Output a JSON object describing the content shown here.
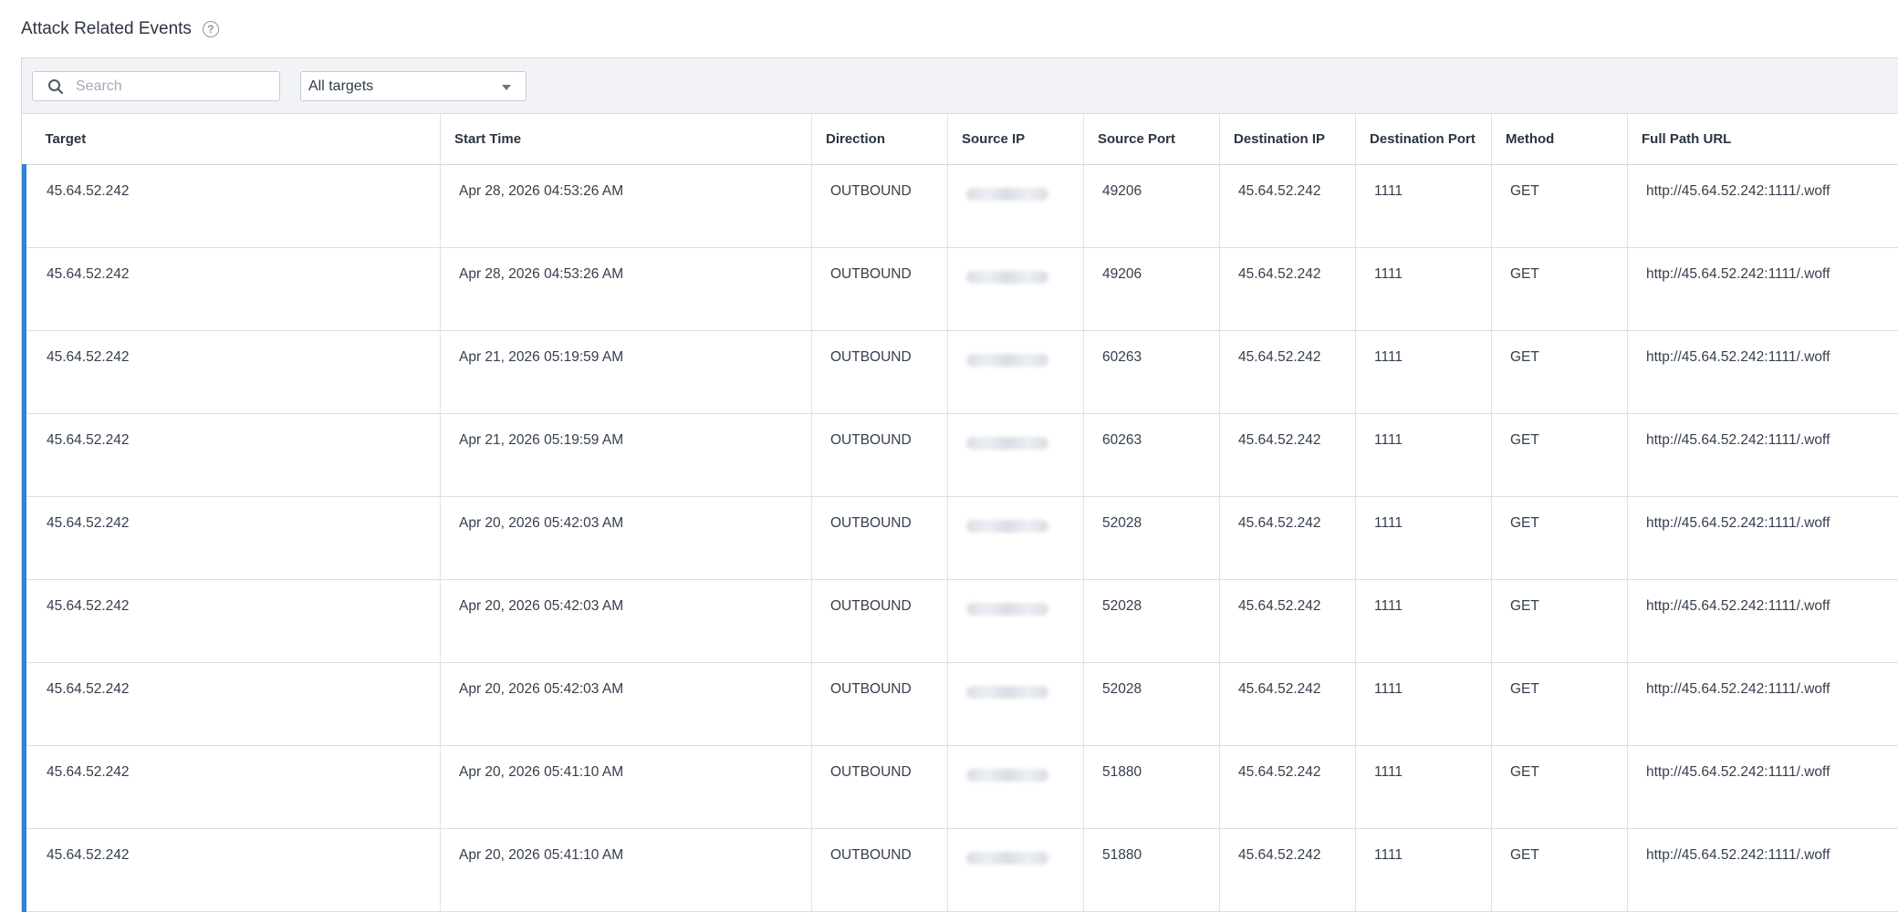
{
  "header": {
    "title": "Attack Related Events",
    "help_glyph": "?"
  },
  "toolbar": {
    "search_placeholder": "Search",
    "target_filter_value": "All targets"
  },
  "table": {
    "columns": [
      "Target",
      "Start Time",
      "Direction",
      "Source IP",
      "Source Port",
      "Destination IP",
      "Destination Port",
      "Method",
      "Full Path URL"
    ],
    "rows": [
      [
        "45.64.52.242",
        "Apr 28, 2026 04:53:26 AM",
        "OUTBOUND",
        "",
        "49206",
        "45.64.52.242",
        "1111",
        "GET",
        "http://45.64.52.242:1111/.woff"
      ],
      [
        "45.64.52.242",
        "Apr 28, 2026 04:53:26 AM",
        "OUTBOUND",
        "",
        "49206",
        "45.64.52.242",
        "1111",
        "GET",
        "http://45.64.52.242:1111/.woff"
      ],
      [
        "45.64.52.242",
        "Apr 21, 2026 05:19:59 AM",
        "OUTBOUND",
        "",
        "60263",
        "45.64.52.242",
        "1111",
        "GET",
        "http://45.64.52.242:1111/.woff"
      ],
      [
        "45.64.52.242",
        "Apr 21, 2026 05:19:59 AM",
        "OUTBOUND",
        "",
        "60263",
        "45.64.52.242",
        "1111",
        "GET",
        "http://45.64.52.242:1111/.woff"
      ],
      [
        "45.64.52.242",
        "Apr 20, 2026 05:42:03 AM",
        "OUTBOUND",
        "",
        "52028",
        "45.64.52.242",
        "1111",
        "GET",
        "http://45.64.52.242:1111/.woff"
      ],
      [
        "45.64.52.242",
        "Apr 20, 2026 05:42:03 AM",
        "OUTBOUND",
        "",
        "52028",
        "45.64.52.242",
        "1111",
        "GET",
        "http://45.64.52.242:1111/.woff"
      ],
      [
        "45.64.52.242",
        "Apr 20, 2026 05:42:03 AM",
        "OUTBOUND",
        "",
        "52028",
        "45.64.52.242",
        "1111",
        "GET",
        "http://45.64.52.242:1111/.woff"
      ],
      [
        "45.64.52.242",
        "Apr 20, 2026 05:41:10 AM",
        "OUTBOUND",
        "",
        "51880",
        "45.64.52.242",
        "1111",
        "GET",
        "http://45.64.52.242:1111/.woff"
      ],
      [
        "45.64.52.242",
        "Apr 20, 2026 05:41:10 AM",
        "OUTBOUND",
        "",
        "51880",
        "45.64.52.242",
        "1111",
        "GET",
        "http://45.64.52.242:1111/.woff"
      ]
    ]
  },
  "colors": {
    "row_accent": "#2f80d6",
    "toolbar_bg": "#f1f3f7"
  }
}
